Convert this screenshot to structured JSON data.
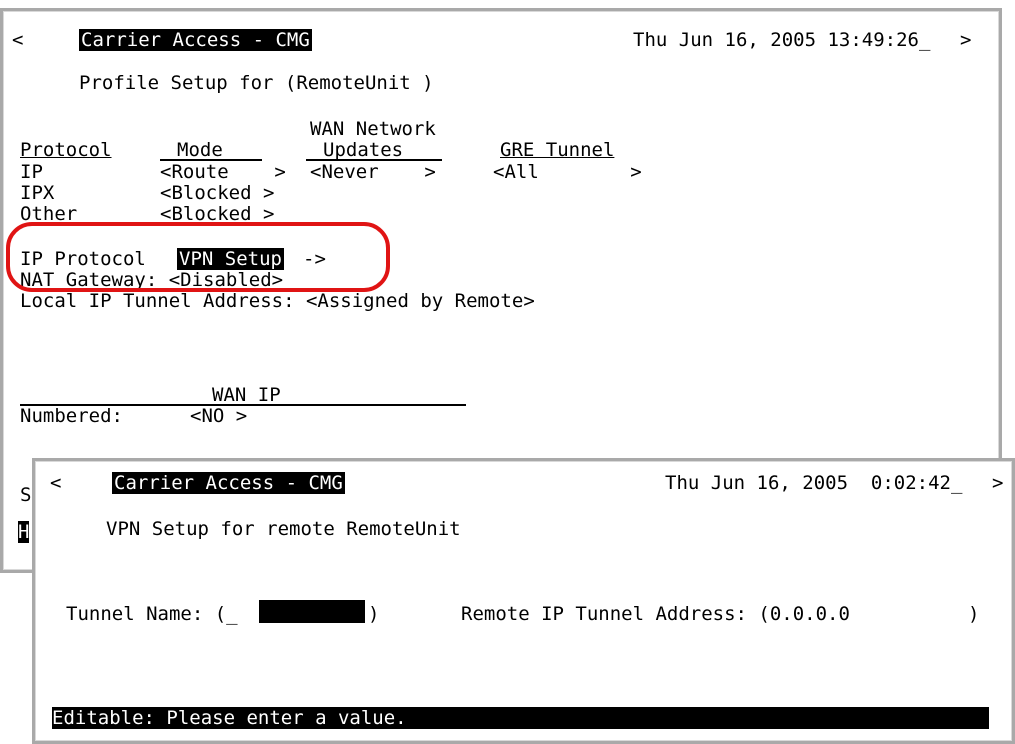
{
  "back_window": {
    "left_arrow": "<",
    "app_title": "Carrier Access - CMG",
    "datetime": "Thu Jun 16, 2005 13:49:26_",
    "right_arrow": ">",
    "heading": "Profile Setup for (RemoteUnit )",
    "table": {
      "headers": {
        "protocol": "Protocol",
        "mode": "Mode",
        "wan_network_1": "WAN Network",
        "wan_network_2": "Updates",
        "gre_tunnel": "GRE Tunnel"
      },
      "rows": [
        {
          "protocol": "IP",
          "mode": "<Route    >",
          "updates": "<Never    >",
          "gre": "<All        >"
        },
        {
          "protocol": "IPX",
          "mode": "<Blocked >"
        },
        {
          "protocol": "Other",
          "mode": "<Blocked >"
        }
      ]
    },
    "ip_protocol_label": "IP Protocol",
    "vpn_setup_link": "VPN Setup",
    "arrow": "->",
    "nat_gateway": "NAT Gateway: <Disabled>",
    "local_ip_tunnel": "Local IP Tunnel Address: <Assigned by Remote>",
    "wan_ip_header": "WAN IP",
    "numbered_label": "Numbered:",
    "numbered_value": "<NO >",
    "partial_s": "S",
    "partial_h": "H"
  },
  "front_window": {
    "left_arrow": "<",
    "app_title": "Carrier Access - CMG",
    "datetime": "Thu Jun 16, 2005  0:02:42_",
    "right_arrow": ">",
    "heading": "VPN Setup for remote RemoteUnit",
    "tunnel_name_label": "Tunnel Name: (_",
    "tunnel_name_close": ")",
    "remote_ip_label": "Remote IP Tunnel Address: (0.0.0.0",
    "remote_ip_close": ")",
    "status_message": "Editable: Please enter a value."
  },
  "colors": {
    "highlight_circle": "#e01414",
    "window_border": "#a9a9a9"
  }
}
